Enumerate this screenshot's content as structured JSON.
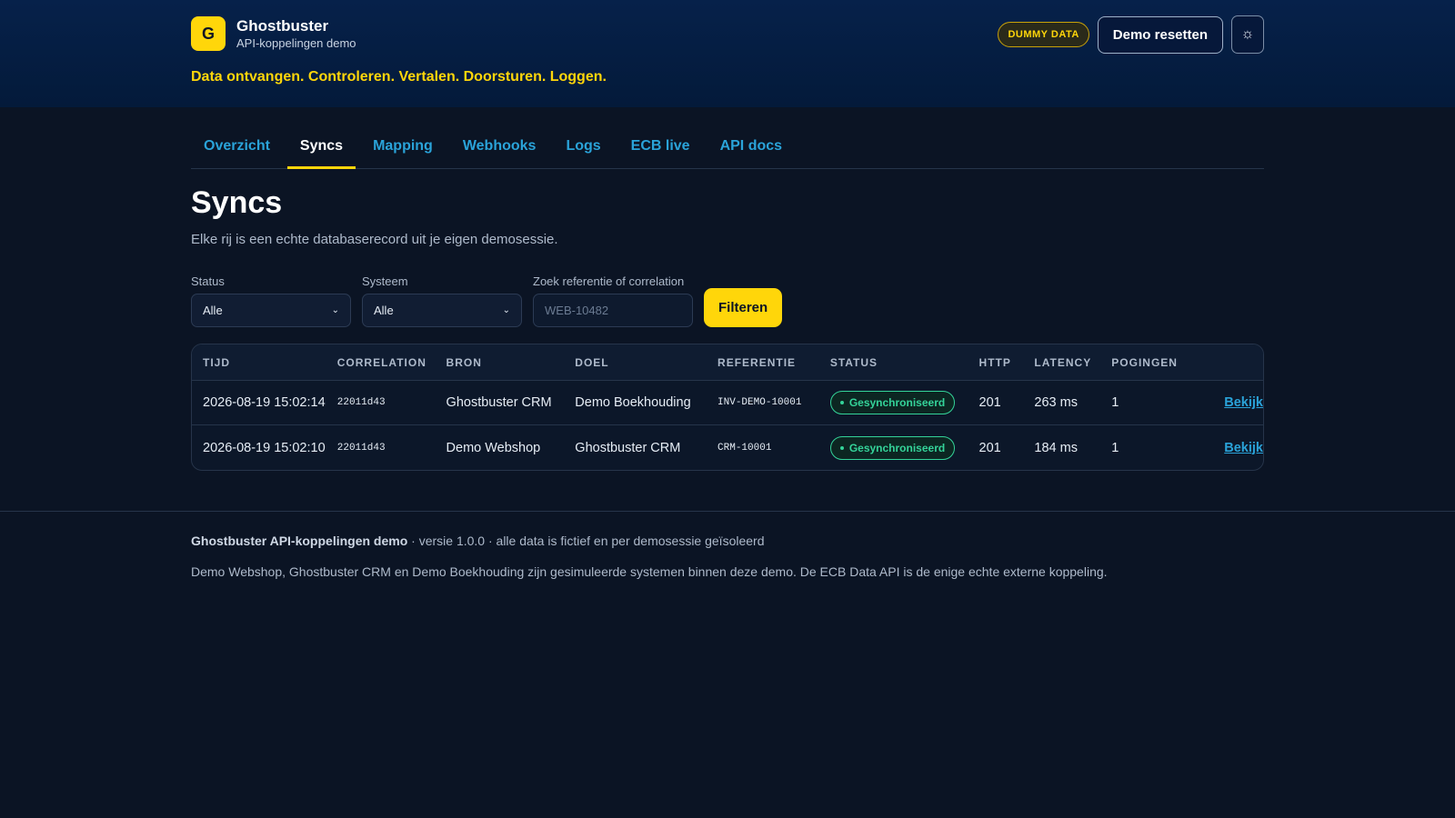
{
  "app": {
    "logo_letter": "G",
    "name": "Ghostbuster",
    "subtitle": "API-koppelingen demo",
    "tagline": "Data ontvangen. Controleren. Vertalen. Doorsturen. Loggen."
  },
  "header": {
    "badge": "DUMMY DATA",
    "reset_label": "Demo resetten",
    "theme_icon": "sun-icon"
  },
  "tabs": [
    {
      "label": "Overzicht",
      "active": false
    },
    {
      "label": "Syncs",
      "active": true
    },
    {
      "label": "Mapping",
      "active": false
    },
    {
      "label": "Webhooks",
      "active": false
    },
    {
      "label": "Logs",
      "active": false
    },
    {
      "label": "ECB live",
      "active": false
    },
    {
      "label": "API docs",
      "active": false
    }
  ],
  "page": {
    "title": "Syncs",
    "subtitle": "Elke rij is een echte databaserecord uit je eigen demosessie."
  },
  "filters": {
    "status_label": "Status",
    "status_value": "Alle",
    "system_label": "Systeem",
    "system_value": "Alle",
    "search_label": "Zoek referentie of correlation",
    "search_placeholder": "WEB-10482",
    "submit_label": "Filteren"
  },
  "table": {
    "headers": [
      "TIJD",
      "CORRELATION",
      "BRON",
      "DOEL",
      "REFERENTIE",
      "STATUS",
      "HTTP",
      "LATENCY",
      "POGINGEN",
      ""
    ],
    "rows": [
      {
        "tijd": "2026-08-19 15:02:14",
        "correlation": "22011d43",
        "bron": "Ghostbuster CRM",
        "doel": "Demo Boekhouding",
        "referentie": "INV-DEMO-10001",
        "status": "Gesynchroniseerd",
        "http": "201",
        "latency": "263 ms",
        "pogingen": "1",
        "action": "Bekijk"
      },
      {
        "tijd": "2026-08-19 15:02:10",
        "correlation": "22011d43",
        "bron": "Demo Webshop",
        "doel": "Ghostbuster CRM",
        "referentie": "CRM-10001",
        "status": "Gesynchroniseerd",
        "http": "201",
        "latency": "184 ms",
        "pogingen": "1",
        "action": "Bekijk"
      }
    ]
  },
  "footer": {
    "product": "Ghostbuster API-koppelingen demo",
    "meta": " · versie 1.0.0 · alle data is fictief en per demosessie geïsoleerd",
    "note": "Demo Webshop, Ghostbuster CRM en Demo Boekhouding zijn gesimuleerde systemen binnen deze demo. De ECB Data API is de enige echte externe koppeling."
  },
  "colors": {
    "accent": "#ffd60a",
    "link": "#2aa3d9",
    "success": "#34d399",
    "background": "#0b1424"
  }
}
